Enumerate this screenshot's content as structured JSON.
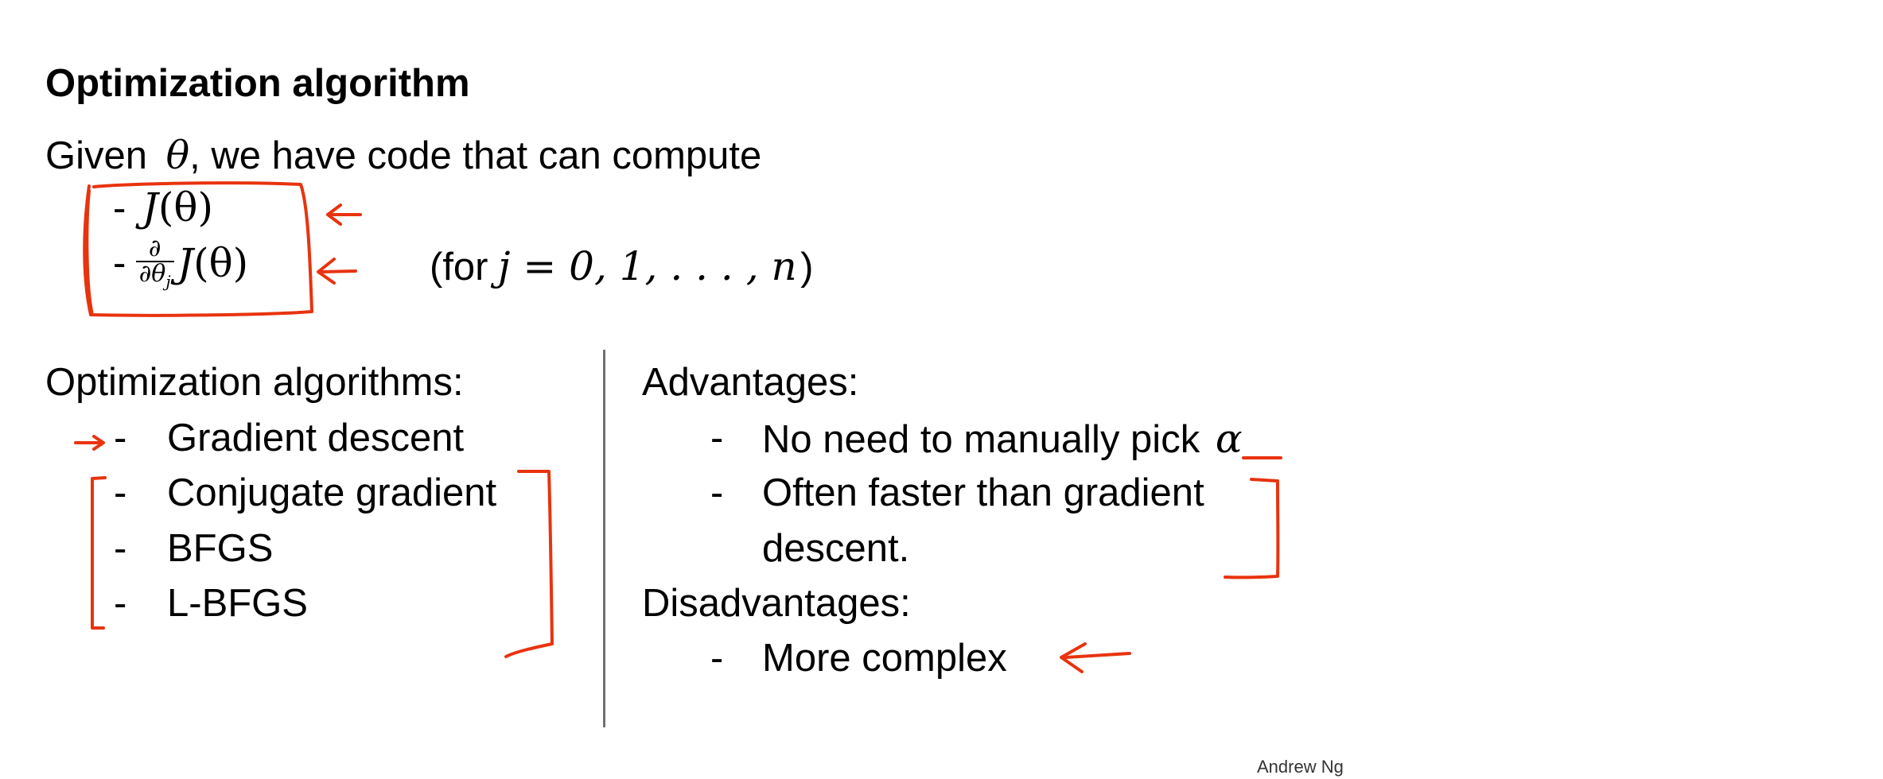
{
  "slide": {
    "title": "Optimization algorithm",
    "given_prefix": "Given",
    "theta": "θ",
    "given_suffix": ", we have code that can compute",
    "bullet_marker": "-",
    "cost_J": "J",
    "cost_arg": "(θ)",
    "partial_num": "∂",
    "partial_den": "∂θ",
    "partial_sub": "j",
    "range_open": "(for",
    "range_math": "j = 0, 1, . . . , n",
    "range_close": ")",
    "algorithms_heading": "Optimization algorithms:",
    "algorithms": [
      "Gradient descent",
      "Conjugate gradient",
      "BFGS",
      "L-BFGS"
    ],
    "advantages_heading": "Advantages:",
    "advantages": [
      "No need to manually pick",
      "Often faster than gradient",
      "descent."
    ],
    "alpha": "α",
    "disadvantages_heading": "Disadvantages:",
    "disadvantages": [
      "More complex"
    ],
    "footer": "Andrew Ng"
  },
  "colors": {
    "annotation": "#e8330f",
    "divider": "#6f6f6f",
    "text": "#000000"
  }
}
